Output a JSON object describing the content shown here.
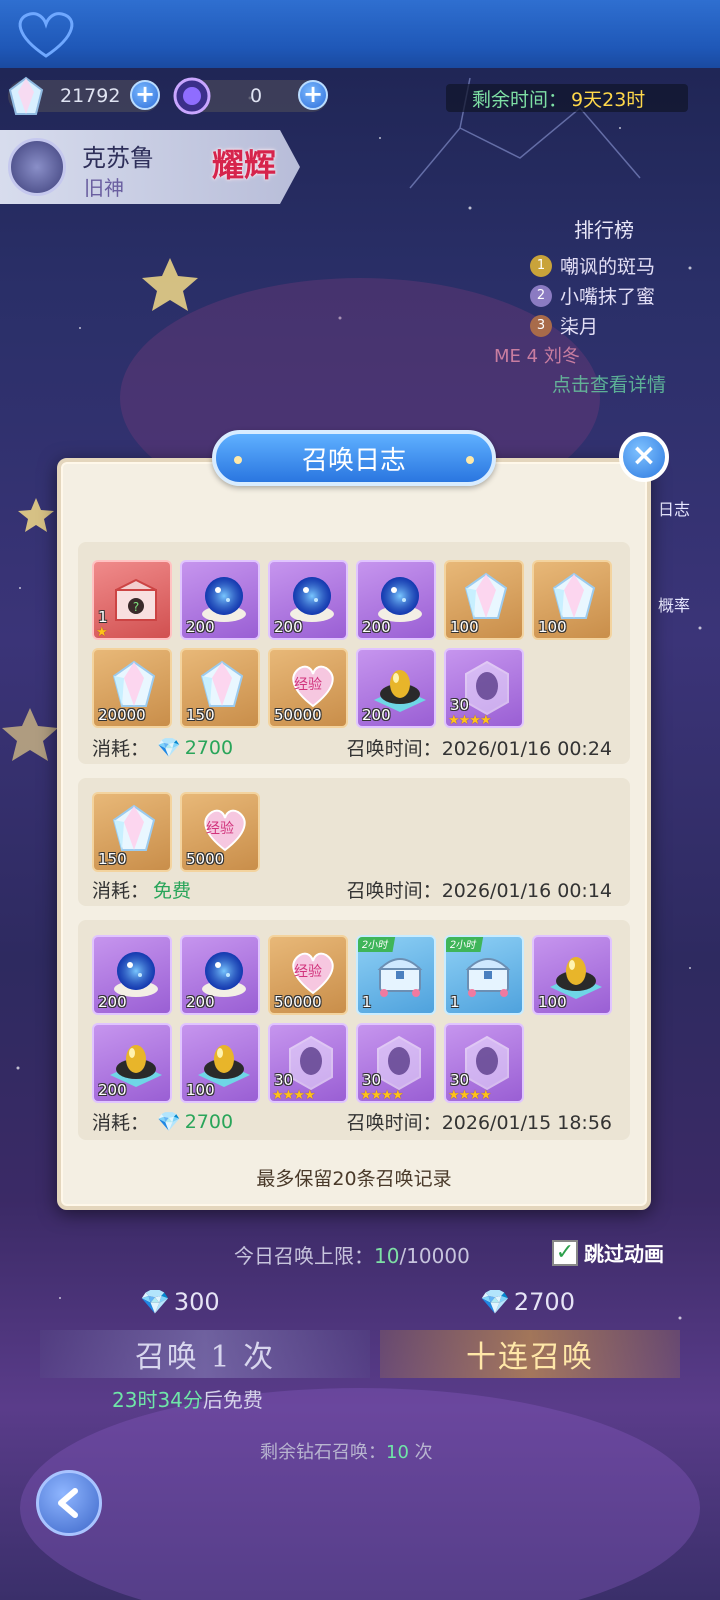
{
  "currency": {
    "gems": "21792",
    "orbs": "0"
  },
  "timer": {
    "label": "剩余时间：",
    "value": "9天23时"
  },
  "god": {
    "name": "克苏鲁",
    "subtitle": "旧神",
    "badge": "耀辉"
  },
  "ranking": {
    "title": "排行榜",
    "entries": [
      {
        "rank": "1",
        "name": "嘲讽的斑马"
      },
      {
        "rank": "2",
        "name": "小嘴抹了蜜"
      },
      {
        "rank": "3",
        "name": "柒月"
      }
    ],
    "me_label": "ME",
    "me_value": "4",
    "me_name": "刘冬",
    "link": "点击查看详情"
  },
  "side_buttons": {
    "log": "日志",
    "rate": "概率"
  },
  "modal": {
    "title": "召唤日志",
    "footer": "最多保留20条召唤记录",
    "cost_label": "消耗：",
    "time_label": "召唤时间：",
    "records": [
      {
        "cost": "2700",
        "time": "2026/01/16 00:24",
        "items": [
          {
            "type": "mystery-box",
            "bg": "red",
            "count": "1",
            "stars": "★"
          },
          {
            "type": "crystal-orb",
            "bg": "purple",
            "count": "200"
          },
          {
            "type": "crystal-orb",
            "bg": "purple",
            "count": "200"
          },
          {
            "type": "crystal-orb",
            "bg": "purple",
            "count": "200"
          },
          {
            "type": "diamond",
            "bg": "gold",
            "count": "100"
          },
          {
            "type": "diamond",
            "bg": "gold",
            "count": "100"
          },
          {
            "type": "diamond",
            "bg": "gold",
            "count": "20000"
          },
          {
            "type": "diamond",
            "bg": "gold",
            "count": "150"
          },
          {
            "type": "exp-heart",
            "bg": "gold",
            "count": "50000",
            "label": "经验"
          },
          {
            "type": "golden-egg",
            "bg": "purple",
            "count": "200"
          },
          {
            "type": "silhouette-crystal",
            "bg": "purple",
            "count": "30",
            "stars": "★★★★"
          }
        ]
      },
      {
        "cost": "免费",
        "time": "2026/01/16 00:14",
        "items": [
          {
            "type": "diamond",
            "bg": "gold",
            "count": "150"
          },
          {
            "type": "exp-heart",
            "bg": "gold",
            "count": "5000",
            "label": "经验"
          }
        ]
      },
      {
        "cost": "2700",
        "time": "2026/01/15 18:56",
        "items": [
          {
            "type": "crystal-orb",
            "bg": "purple",
            "count": "200"
          },
          {
            "type": "crystal-orb",
            "bg": "purple",
            "count": "200"
          },
          {
            "type": "exp-heart",
            "bg": "gold",
            "count": "50000",
            "label": "经验"
          },
          {
            "type": "treasure-chest",
            "bg": "blue",
            "count": "1",
            "tag": "2小时"
          },
          {
            "type": "treasure-chest",
            "bg": "blue",
            "count": "1",
            "tag": "2小时"
          },
          {
            "type": "golden-egg",
            "bg": "purple",
            "count": "100"
          },
          {
            "type": "golden-egg",
            "bg": "purple",
            "count": "200"
          },
          {
            "type": "golden-egg",
            "bg": "purple",
            "count": "100"
          },
          {
            "type": "silhouette-crystal",
            "bg": "purple",
            "count": "30",
            "stars": "★★★★"
          },
          {
            "type": "silhouette-crystal",
            "bg": "purple",
            "count": "30",
            "stars": "★★★★"
          },
          {
            "type": "silhouette-crystal",
            "bg": "purple",
            "count": "30",
            "stars": "★★★★"
          }
        ]
      }
    ]
  },
  "bottom": {
    "limit_label": "今日召唤上限：",
    "limit_used": "10",
    "limit_total": "/10000",
    "skip_label": "跳过动画",
    "single_price": "300",
    "ten_price": "2700",
    "single_label": "召唤 1 次",
    "ten_label": "十连召唤",
    "free_time": "23时34分",
    "free_suffix": "后免费",
    "remain_label": "剩余钻石召唤：",
    "remain_value": "10",
    "remain_suffix": " 次"
  },
  "colors": {
    "accent_blue": "#2a76e0",
    "green_text": "#29a55a",
    "gold_text": "#ffd84a"
  }
}
